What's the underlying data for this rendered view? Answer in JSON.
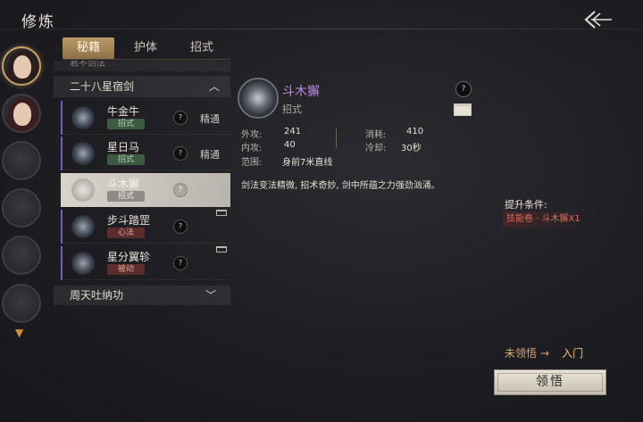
{
  "header": {
    "title": "修炼",
    "back_icon": "back-arrow-icon"
  },
  "tabs": [
    {
      "label": "秘籍",
      "active": true
    },
    {
      "label": "护体",
      "active": false
    },
    {
      "label": "招式",
      "active": false
    }
  ],
  "list": {
    "top_category": "君不剑法",
    "group": {
      "label": "二十八星宿剑",
      "expanded": true
    },
    "items": [
      {
        "name": "牛金牛",
        "tag": "招式",
        "tag_color": "green",
        "level": "精通",
        "selected": false
      },
      {
        "name": "星日马",
        "tag": "招式",
        "tag_color": "green",
        "level": "精通",
        "selected": false
      },
      {
        "name": "斗木獬",
        "tag": "招式",
        "tag_color": "gray",
        "level": "",
        "selected": true
      },
      {
        "name": "步斗踏罡",
        "tag": "心法",
        "tag_color": "red",
        "level": "",
        "selected": false
      },
      {
        "name": "星分翼轸",
        "tag": "被动",
        "tag_color": "red",
        "level": "",
        "selected": false
      }
    ],
    "bottom_category": "周天吐纳功"
  },
  "detail": {
    "name": "斗木獬",
    "type": "招式",
    "stats": {
      "attack_out_label": "外攻:",
      "attack_out": "241",
      "attack_in_label": "内攻:",
      "attack_in": "40",
      "cost_label": "消耗:",
      "cost": "410",
      "cooldown_label": "冷却:",
      "cooldown": "30秒",
      "range_label": "范围:",
      "range": "身前7米直线"
    },
    "description": "剑法变法精微, 招术奇妙, 剑中所蕴之力强劲汹涌。",
    "requirement_label": "提升条件:",
    "requirement_value": "技能卷 · 斗木獬X1"
  },
  "progress": {
    "from": "未领悟",
    "to": "入门"
  },
  "learn_button": "领悟",
  "colors": {
    "accent_gold": "#c9a266",
    "skill_purple": "#b88be0",
    "requirement_red": "#e06a5a"
  }
}
